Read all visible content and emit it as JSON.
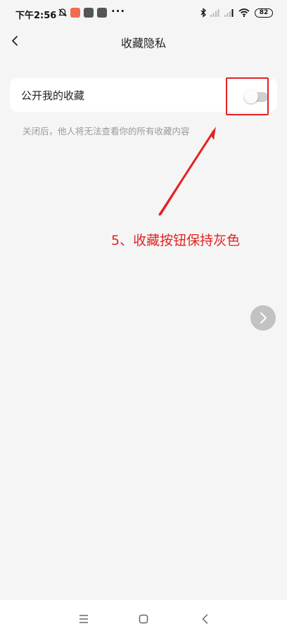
{
  "status_bar": {
    "time": "下午2:56",
    "more": "···",
    "battery": "82",
    "icons": [
      "mute-bell-icon",
      "app-notification-icon",
      "app-notification-icon",
      "app-notification-icon",
      "bluetooth-icon",
      "signal-icon",
      "signal-icon",
      "wifi-icon",
      "battery-icon"
    ]
  },
  "header": {
    "title": "收藏隐私",
    "back_icon": "chevron-left-icon"
  },
  "setting": {
    "label": "公开我的收藏",
    "toggle_state": "off",
    "hint": "关闭后，他人将无法查看你的所有收藏内容"
  },
  "annotation": {
    "text": "5、收藏按钮保持灰色",
    "color": "#e52222"
  },
  "floating": {
    "next_icon": "chevron-right-icon"
  },
  "nav": {
    "items": [
      "menu-icon",
      "home-square-icon",
      "back-icon"
    ]
  },
  "colors": {
    "background": "#f5f5f5",
    "card": "#ffffff",
    "toggle_off": "#d0d0d0",
    "highlight": "#e52222"
  }
}
